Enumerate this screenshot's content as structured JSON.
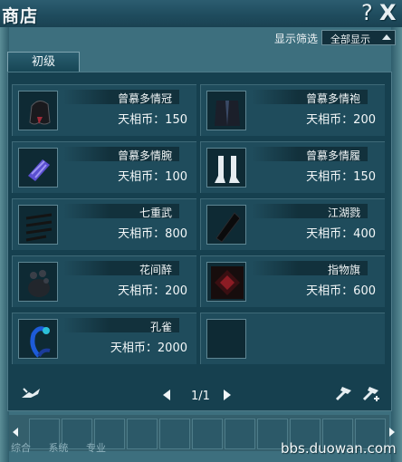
{
  "window": {
    "title": "商店",
    "help_symbol": "?",
    "close_symbol": "X"
  },
  "filter": {
    "label": "显示筛选",
    "value": "全部显示"
  },
  "tabs": [
    {
      "label": "初级"
    }
  ],
  "items": [
    {
      "name": "曾慕多情冠",
      "price": "天相币：150",
      "icon": "hood-icon"
    },
    {
      "name": "曾慕多情袍",
      "price": "天相币：200",
      "icon": "robe-icon"
    },
    {
      "name": "曾慕多情腕",
      "price": "天相币：100",
      "icon": "bracer-icon"
    },
    {
      "name": "曾慕多情履",
      "price": "天相币：150",
      "icon": "boots-icon"
    },
    {
      "name": "七重武",
      "price": "天相币：800",
      "icon": "weapons-icon"
    },
    {
      "name": "江湖戮",
      "price": "天相币：400",
      "icon": "blade-icon"
    },
    {
      "name": "花间醉",
      "price": "天相币：200",
      "icon": "flower-jar-icon"
    },
    {
      "name": "指物旗",
      "price": "天相币：600",
      "icon": "banner-icon"
    },
    {
      "name": "孔雀",
      "price": "天相币：2000",
      "icon": "peacock-icon"
    }
  ],
  "pager": {
    "text": "1/1"
  },
  "bottom_tabs": [
    "综合",
    "系统",
    "专业"
  ],
  "watermark": "bbs.duowan.com"
}
